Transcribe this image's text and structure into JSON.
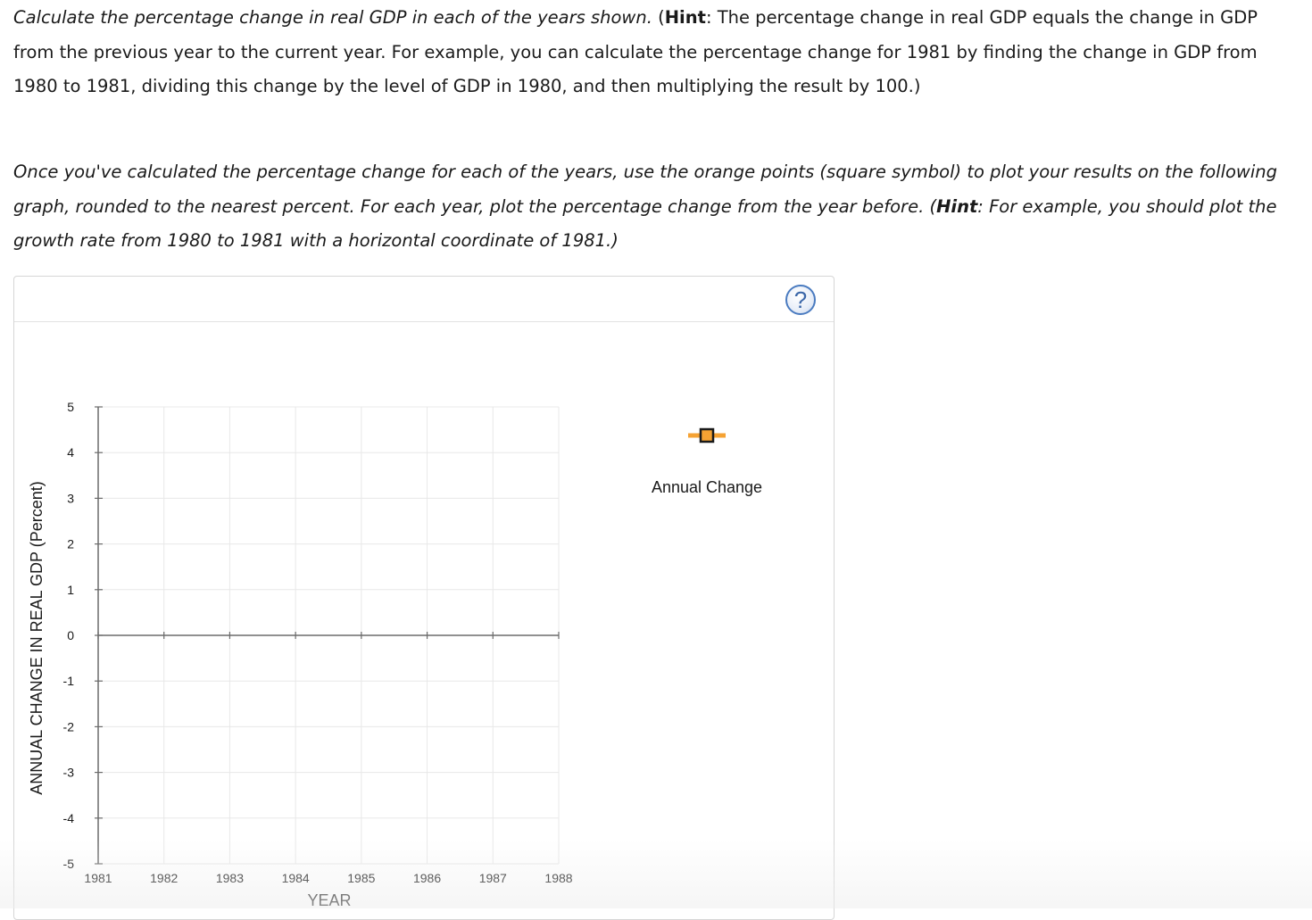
{
  "instructions": {
    "p1": {
      "intro_italic": "Calculate the percentage change in real GDP in each of the years shown.",
      "open": " (",
      "hint_label": "Hint",
      "hint_text": ": The percentage change in real GDP equals the change in GDP from the previous year to the current year. For example, you can calculate the percentage change for 1981 by finding the change in GDP from 1980 to 1981, dividing this change by the level of GDP in 1980, and then multiplying the result by 100.)"
    },
    "p2": {
      "text": "Once you've calculated the percentage change for each of the years, use the orange points (square symbol) to plot your results on the following graph, rounded to the nearest percent. For each year, plot the percentage change from the year before. (",
      "hint_label": "Hint",
      "hint_text": ": For example, you should plot the growth rate from 1980 to 1981 with a horizontal coordinate of 1981.)"
    }
  },
  "help_button": {
    "label": "?"
  },
  "tool": {
    "label": "Annual Change",
    "icon": "orange-square-point-icon",
    "color": "#f5a233"
  },
  "chart_data": {
    "type": "scatter",
    "title": "",
    "xlabel": "YEAR",
    "ylabel": "ANNUAL CHANGE IN REAL GDP (Percent)",
    "x_ticks": [
      "1981",
      "1982",
      "1983",
      "1984",
      "1985",
      "1986",
      "1987",
      "1988"
    ],
    "y_ticks": [
      "5",
      "4",
      "3",
      "2",
      "1",
      "0",
      "-1",
      "-2",
      "-3",
      "-4",
      "-5"
    ],
    "xlim": [
      1981,
      1988
    ],
    "ylim": [
      -5,
      5
    ],
    "grid": true,
    "series": [
      {
        "name": "Annual Change",
        "points": []
      }
    ]
  }
}
